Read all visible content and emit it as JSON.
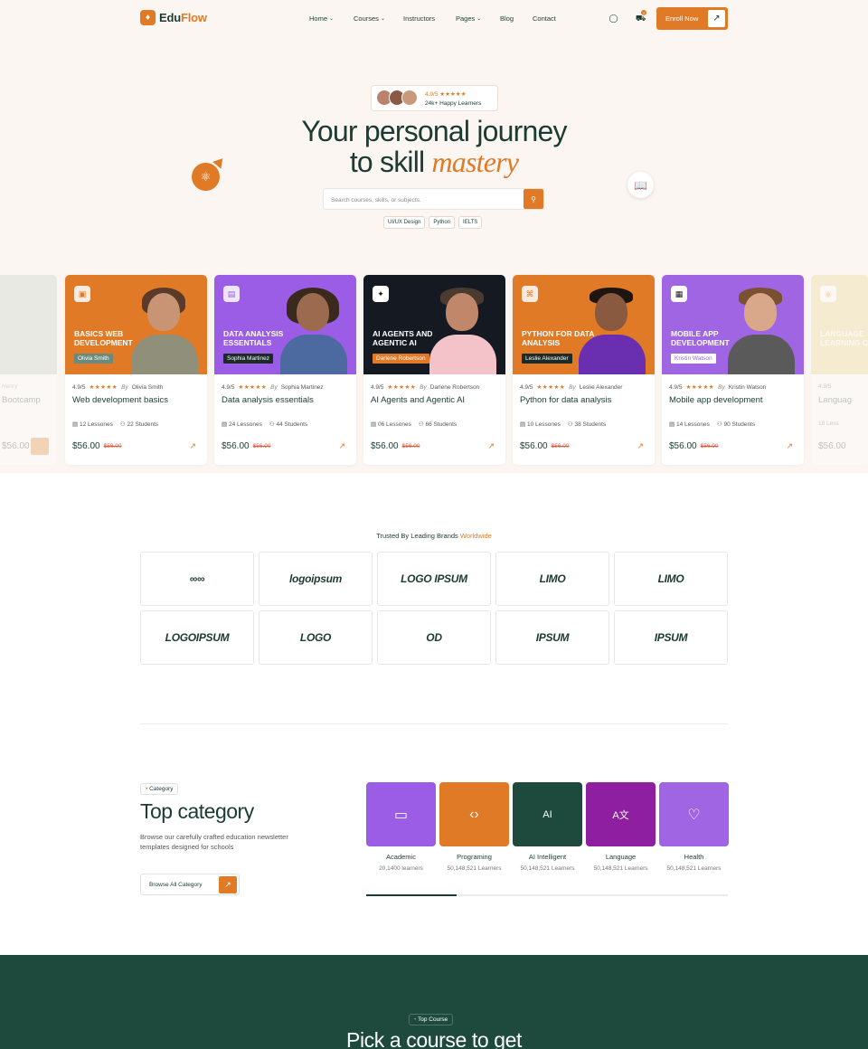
{
  "brand": {
    "name_main": "Edu",
    "name_accent": "Flow"
  },
  "nav": {
    "items": [
      {
        "label": "Home",
        "has_dropdown": true
      },
      {
        "label": "Courses",
        "has_dropdown": true
      },
      {
        "label": "Instructors",
        "has_dropdown": false
      },
      {
        "label": "Pages",
        "has_dropdown": true
      },
      {
        "label": "Blog",
        "has_dropdown": false
      },
      {
        "label": "Contact",
        "has_dropdown": false
      }
    ],
    "cart_count": "2",
    "cta_label": "Enroll Now"
  },
  "hero": {
    "rating": "4.9/5 ★★★★★",
    "learners": "24k+ Happy Learners",
    "title_line1": "Your personal journey",
    "title_line2_plain": "to skill ",
    "title_line2_accent": "mastery",
    "search_placeholder": "Search courses, skills, or subjects.",
    "chips": [
      "UI/UX Design",
      "Python",
      "IELTS"
    ]
  },
  "courses": [
    {
      "image_title": "",
      "tag": "",
      "rating": "4.9/5",
      "instructor": "Henry",
      "name": "Bootcamp",
      "lessons": "",
      "students": "",
      "price": "$56.00",
      "old_price": ""
    },
    {
      "image_title": "BASICS WEB DEVELOPMENT",
      "tag": "Olivia Smith",
      "rating": "4.9/5",
      "instructor": "Olivia Smith",
      "name": "Web development basics",
      "lessons": "12 Lessones",
      "students": "22 Students",
      "price": "$56.00",
      "old_price": "$56.00"
    },
    {
      "image_title": "DATA ANALYSIS ESSENTIALS",
      "tag": "Sophia Martinez",
      "rating": "4.9/5",
      "instructor": "Sophia Martinez",
      "name": "Data analysis essentials",
      "lessons": "24 Lessones",
      "students": "44 Students",
      "price": "$56.00",
      "old_price": "$56.00"
    },
    {
      "image_title": "AI AGENTS AND AGENTIC AI",
      "tag": "Darlene Robertson",
      "rating": "4.9/5",
      "instructor": "Darlene Robertson",
      "name": "AI Agents and Agentic AI",
      "lessons": "06 Lessones",
      "students": "66 Students",
      "price": "$56.00",
      "old_price": "$56.00"
    },
    {
      "image_title": "PYTHON FOR DATA ANALYSIS",
      "tag": "Leslie Alexander",
      "rating": "4.9/5",
      "instructor": "Leslie Alexander",
      "name": "Python for data analysis",
      "lessons": "10 Lessones",
      "students": "38 Students",
      "price": "$56.00",
      "old_price": "$56.00"
    },
    {
      "image_title": "MOBILE APP DEVELOPMENT",
      "tag": "Kristin Watson",
      "rating": "4.9/5",
      "instructor": "Kristin Watson",
      "name": "Mobile app development",
      "lessons": "14 Lessones",
      "students": "90 Students",
      "price": "$56.00",
      "old_price": "$56.00"
    },
    {
      "image_title": "LANGUAGE LEARNING COURSE",
      "tag": "",
      "rating": "4.9/5",
      "instructor": "",
      "name": "Languag",
      "lessons": "18 Less",
      "students": "",
      "price": "$56.00",
      "old_price": ""
    }
  ],
  "card_text": {
    "by": "By",
    "stars": "★★★★★"
  },
  "trusted": {
    "prefix": "Trusted By Leading Brands ",
    "accent": "Worldwide"
  },
  "brands": [
    "∞∞",
    "logoipsum",
    "LOGO IPSUM",
    "LIMO",
    "LIMO",
    "LOGOIPSUM",
    "LOGO",
    "OD",
    "IPSUM",
    "IPSUM"
  ],
  "category": {
    "tag": "Category",
    "title": "Top category",
    "description": "Browse our carefully crafted education newsletter templates designed for schools",
    "browse_label": "Browse All Category",
    "items": [
      {
        "name": "Academic",
        "count": "20,1400 learners",
        "color": "#9b5de5",
        "icon": "certificate-icon"
      },
      {
        "name": "Programing",
        "count": "50,148,521 Learners",
        "color": "#e07a26",
        "icon": "code-icon"
      },
      {
        "name": "AI Intelligent",
        "count": "50,148,521 Learners",
        "color": "#1d4a3c",
        "icon": "ai-icon"
      },
      {
        "name": "Language",
        "count": "50,148,521 Learners",
        "color": "#8e1fa0",
        "icon": "translate-icon"
      },
      {
        "name": "Health",
        "count": "50,148,521 Learners",
        "color": "#a065e3",
        "icon": "heart-pulse-icon"
      }
    ],
    "progress": 0.25
  },
  "top_course": {
    "tag": "Top Course",
    "title": "Pick a course to get"
  },
  "colors": {
    "accent": "#e07a26",
    "primary": "#1c3b33",
    "dark_section": "#1d4a3c"
  }
}
